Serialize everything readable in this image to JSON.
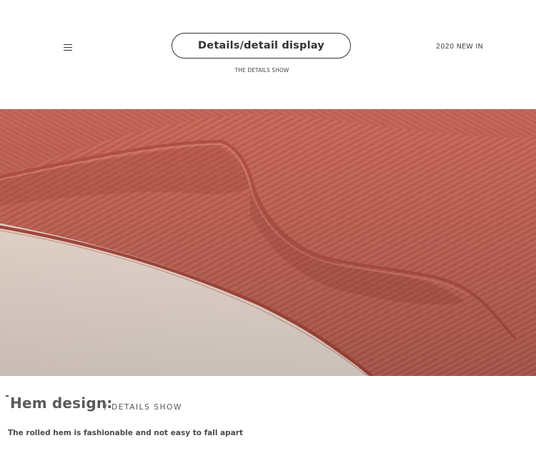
{
  "header": {
    "menu_icon": "hamburger-menu-icon",
    "pill_label": "Details/detail display",
    "pill_subtitle": "THE DETAILS SHOW",
    "new_in": "2020 NEW IN"
  },
  "photo": {
    "subject": "knit-hem-closeup",
    "colors": {
      "knit": "#c96a58",
      "knit_shadow": "#a8493c",
      "knit_highlight": "#d98a78",
      "backdrop": "#f4e6dc"
    }
  },
  "caption": {
    "title": "Hem design:",
    "subtitle": "/ DETAILS SHOW",
    "description": "The rolled hem is fashionable and not easy to fall apart"
  }
}
